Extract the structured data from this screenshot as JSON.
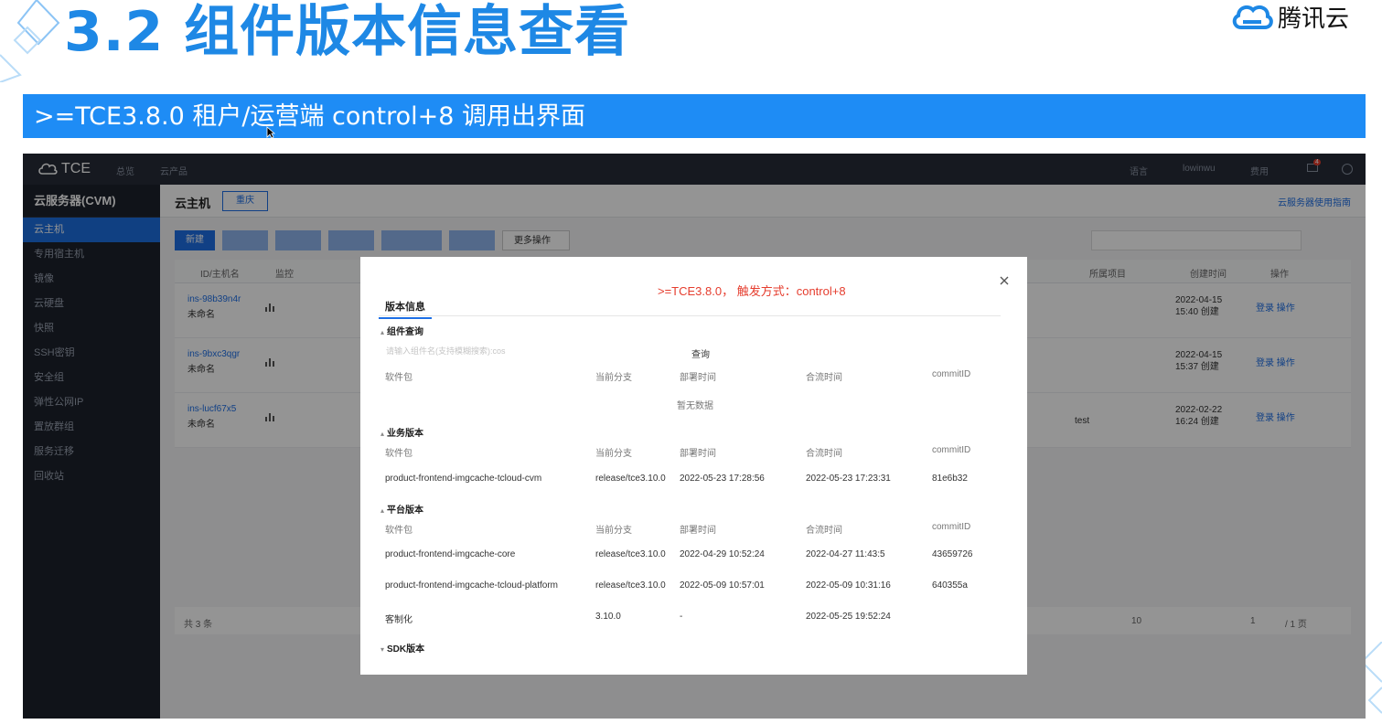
{
  "slide": {
    "title": "3.2 组件版本信息查看",
    "brand": "腾讯云",
    "banner": ">=TCE3.8.0 租户/运营端  control+8 调用出界面"
  },
  "app": {
    "logo": "TCE",
    "topnav": {
      "item1": "总览",
      "item2": "云产品",
      "lang": "语言",
      "user": "lowinwu",
      "cost": "费用",
      "notify_count": "4"
    },
    "sidebar": {
      "title": "云服务器(CVM)",
      "items": [
        "云主机",
        "专用宿主机",
        "镜像",
        "云硬盘",
        "快照",
        "SSH密钥",
        "安全组",
        "弹性公网IP",
        "置放群组",
        "服务迁移",
        "回收站"
      ]
    },
    "main": {
      "title": "云主机",
      "region": "重庆",
      "guide": "云服务器使用指南",
      "new_btn": "新建",
      "more_btn": "更多操作",
      "columns": {
        "id": "ID/主机名",
        "monitor": "监控",
        "project": "所属项目",
        "created": "创建时间",
        "ops": "操作"
      },
      "rows": [
        {
          "id": "ins-98b39n4r",
          "name": "未命名",
          "project": "",
          "created_date": "2022-04-15",
          "created_time": "15:40 创建",
          "login": "登录",
          "op": "操作"
        },
        {
          "id": "ins-9bxc3qgr",
          "name": "未命名",
          "project": "",
          "created_date": "2022-04-15",
          "created_time": "15:37 创建",
          "login": "登录",
          "op": "操作"
        },
        {
          "id": "ins-lucf67x5",
          "name": "未命名",
          "project": "test",
          "created_date": "2022-02-22",
          "created_time": "16:24 创建",
          "login": "登录",
          "op": "操作"
        }
      ],
      "footer": {
        "total": "共 3 条",
        "page_size": "10",
        "page": "1",
        "page_total": "/ 1 页"
      }
    }
  },
  "modal": {
    "trigger_note": ">=TCE3.8.0， 触发方式：control+8",
    "tab": "版本信息",
    "headers": {
      "pkg": "软件包",
      "branch": "当前分支",
      "deploy": "部署时间",
      "merge": "合流时间",
      "commit": "commitID"
    },
    "component": {
      "title": "组件查询",
      "placeholder": "请输入组件名(支持模糊搜索):cos",
      "query_btn": "查询",
      "empty": "暂无数据"
    },
    "business": {
      "title": "业务版本",
      "rows": [
        {
          "pkg": "product-frontend-imgcache-tcloud-cvm",
          "branch": "release/tce3.10.0",
          "deploy": "2022-05-23 17:28:56",
          "merge": "2022-05-23 17:23:31",
          "commit": "81e6b32"
        }
      ]
    },
    "platform": {
      "title": "平台版本",
      "rows": [
        {
          "pkg": "product-frontend-imgcache-core",
          "branch": "release/tce3.10.0",
          "deploy": "2022-04-29 10:52:24",
          "merge": "2022-04-27 11:43:5",
          "commit": "43659726"
        },
        {
          "pkg": "product-frontend-imgcache-tcloud-platform",
          "branch": "release/tce3.10.0",
          "deploy": "2022-05-09 10:57:01",
          "merge": "2022-05-09 10:31:16",
          "commit": "640355a"
        },
        {
          "pkg": "客制化",
          "branch": "3.10.0",
          "deploy": "-",
          "merge": "2022-05-25 19:52:24",
          "commit": ""
        }
      ]
    },
    "sdk": {
      "title": "SDK版本"
    }
  },
  "colors": {
    "accent": "#1e88e5",
    "banner": "#1e8cf5",
    "trigger": "#e53d2e",
    "sidebar_active": "#1d6fe0"
  }
}
